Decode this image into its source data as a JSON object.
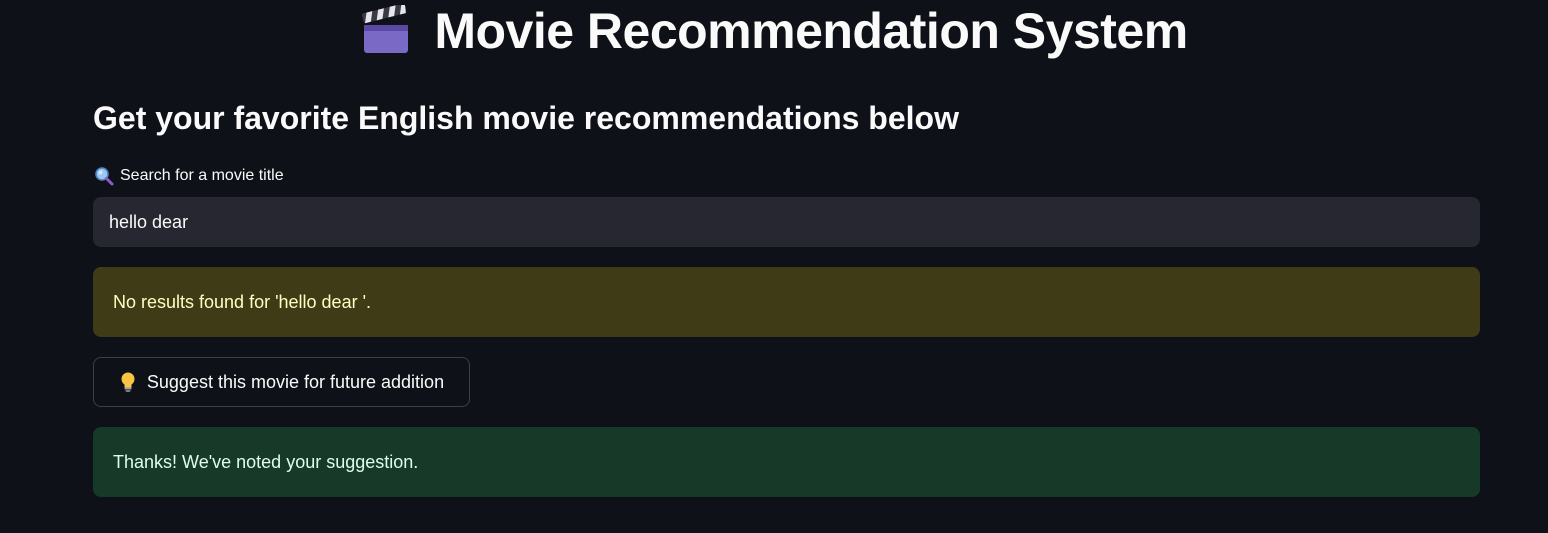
{
  "app": {
    "title": "Movie Recommendation System",
    "subtitle": "Get your favorite English movie recommendations below"
  },
  "search": {
    "label": "Search for a movie title",
    "value": "hello dear"
  },
  "alerts": {
    "warning": "No results found for 'hello dear '.",
    "success": "Thanks! We've noted your suggestion."
  },
  "buttons": {
    "suggest_label": "Suggest this movie for future addition"
  },
  "icons": {
    "title": "clapper-board-icon",
    "search": "magnifying-glass-icon",
    "suggest": "light-bulb-icon"
  },
  "colors": {
    "background": "#0e1117",
    "input_bg": "#262730",
    "warning_bg": "#3f3b17",
    "warning_text": "#ffffc2",
    "success_bg": "#173928",
    "success_text": "#dffde9"
  }
}
